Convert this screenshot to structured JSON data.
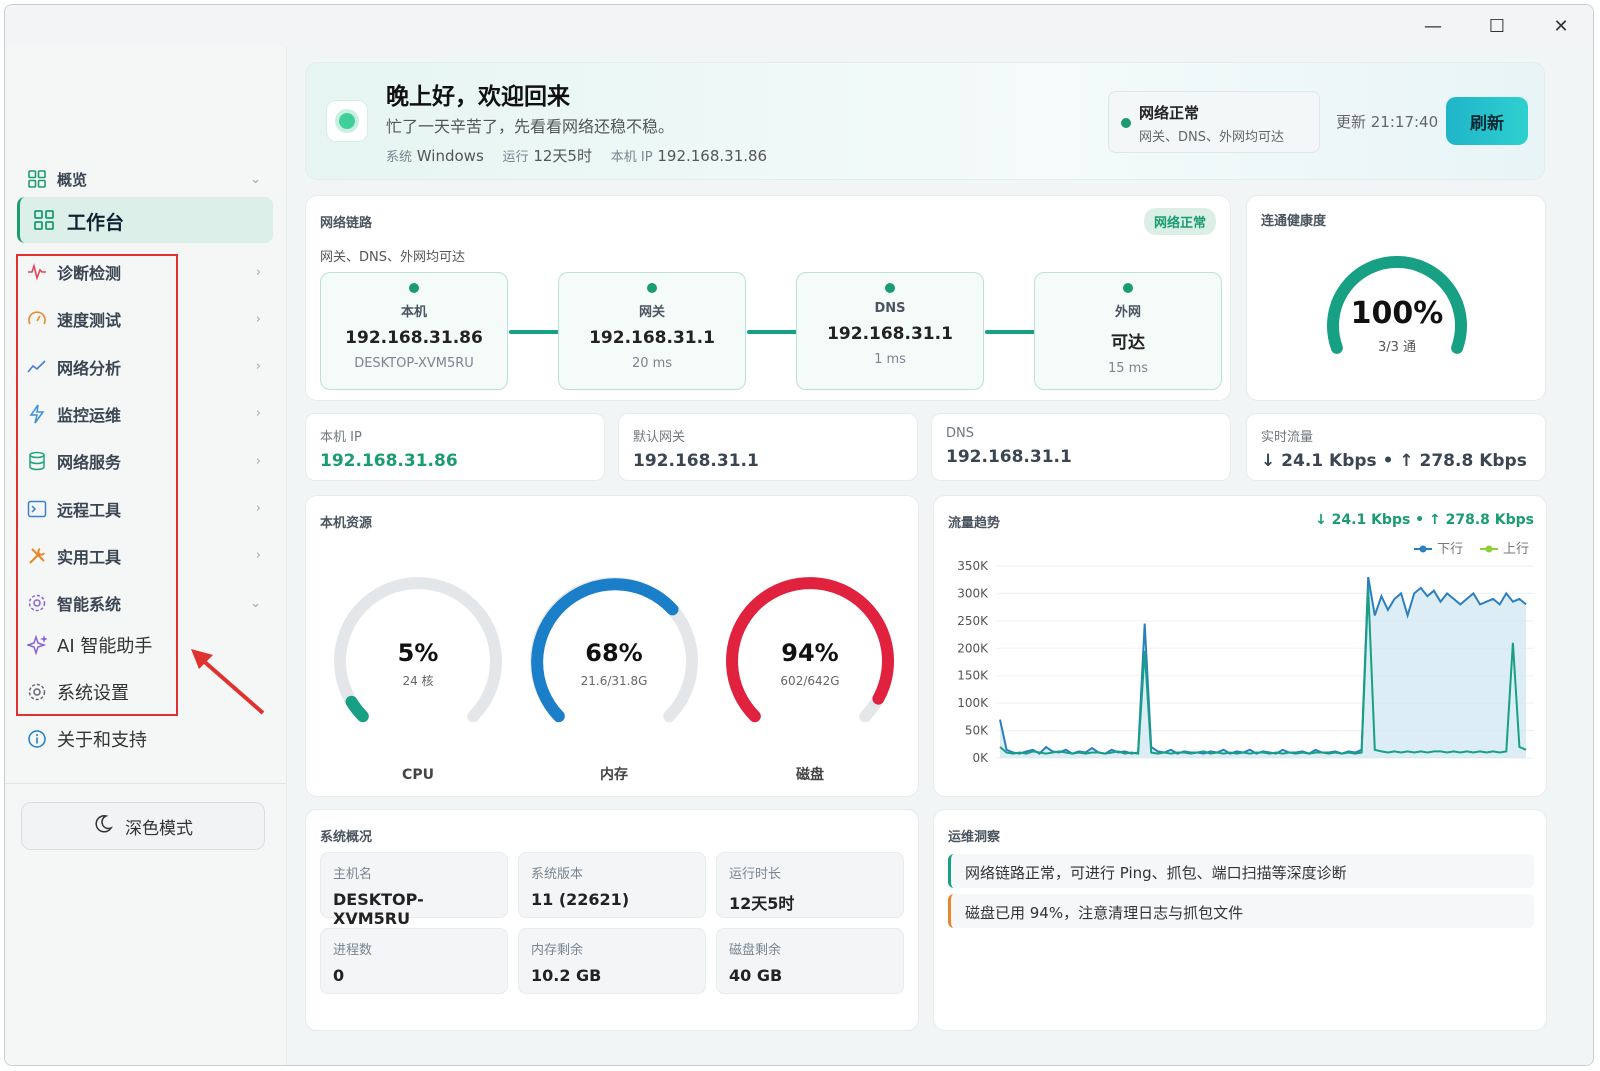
{
  "window": {
    "minimize_label": "—",
    "maximize_label": "☐",
    "close_label": "✕"
  },
  "sidebar": {
    "group_overview": "概览",
    "active_item": "工作台",
    "items": [
      {
        "label": "诊断检测",
        "icon": "pulse-icon",
        "color": "#e0485a"
      },
      {
        "label": "速度测试",
        "icon": "speedometer-icon",
        "color": "#e8872a"
      },
      {
        "label": "网络分析",
        "icon": "trend-icon",
        "color": "#4a7bd8"
      },
      {
        "label": "监控运维",
        "icon": "bolt-icon",
        "color": "#3a8fd8"
      },
      {
        "label": "网络服务",
        "icon": "database-icon",
        "color": "#1fa37e"
      },
      {
        "label": "远程工具",
        "icon": "terminal-icon",
        "color": "#3a7fd0"
      },
      {
        "label": "实用工具",
        "icon": "tools-icon",
        "color": "#e8872a"
      },
      {
        "label": "智能系统",
        "icon": "gear-icon",
        "color": "#8a63d2"
      }
    ],
    "sub_items": [
      {
        "label": "AI 智能助手",
        "icon": "sparkle-icon"
      },
      {
        "label": "系统设置",
        "icon": "gear-icon"
      }
    ],
    "about": "关于和支持",
    "dark_mode": "深色模式",
    "accent": "#1a9b72",
    "highlight_border": "#e03131"
  },
  "header": {
    "greeting": "晚上好，欢迎回来",
    "subtitle": "忙了一天辛苦了，先看看网络还稳不稳。",
    "sys_label": "系统",
    "sys_value": "Windows",
    "uptime_label": "运行",
    "uptime_value": "12天5时",
    "ip_label": "本机 IP",
    "ip_value": "192.168.31.86",
    "status_title": "网络正常",
    "status_desc": "网关、DNS、外网均可达",
    "update_time": "更新 21:17:40",
    "refresh": "刷新"
  },
  "link_card": {
    "title": "网络链路",
    "badge": "网络正常",
    "desc": "网关、DNS、外网均可达",
    "nodes": [
      {
        "name": "本机",
        "value": "192.168.31.86",
        "detail": "DESKTOP-XVM5RU"
      },
      {
        "name": "网关",
        "value": "192.168.31.1",
        "detail": "20 ms"
      },
      {
        "name": "DNS",
        "value": "192.168.31.1",
        "detail": "1 ms"
      },
      {
        "name": "外网",
        "value": "可达",
        "detail": "15 ms"
      }
    ]
  },
  "health": {
    "title": "连通健康度",
    "value": "100%",
    "sub": "3/3 通",
    "percent": 100
  },
  "stats": [
    {
      "label": "本机 IP",
      "value": "192.168.31.86"
    },
    {
      "label": "默认网关",
      "value": "192.168.31.1"
    },
    {
      "label": "DNS",
      "value": "192.168.31.1"
    },
    {
      "label": "实时流量",
      "value": "↓ 24.1 Kbps • ↑ 278.8 Kbps"
    }
  ],
  "resources": {
    "title": "本机资源",
    "gauges": [
      {
        "name": "CPU",
        "value": "5%",
        "sub": "24 核",
        "percent": 5,
        "color": "#17a083"
      },
      {
        "name": "内存",
        "value": "68%",
        "sub": "21.6/31.8G",
        "percent": 68,
        "color": "#1a7fc8"
      },
      {
        "name": "磁盘",
        "value": "94%",
        "sub": "602/642G",
        "percent": 94,
        "color": "#e0223f"
      }
    ]
  },
  "traffic": {
    "title": "流量趋势",
    "summary": "↓ 24.1 Kbps • ↑ 278.8 Kbps",
    "legend_down": "下行",
    "legend_up": "上行"
  },
  "chart_data": {
    "type": "line",
    "ylim": [
      0,
      350
    ],
    "y_ticks": [
      "0K",
      "50K",
      "100K",
      "150K",
      "200K",
      "250K",
      "300K",
      "350K"
    ],
    "series": [
      {
        "name": "下行",
        "color": "#2b7fc0",
        "values": [
          70,
          15,
          10,
          8,
          12,
          15,
          8,
          20,
          12,
          10,
          15,
          8,
          12,
          10,
          18,
          10,
          8,
          15,
          10,
          12,
          8,
          10,
          245,
          20,
          12,
          10,
          15,
          8,
          12,
          10,
          10,
          8,
          12,
          10,
          15,
          8,
          12,
          10,
          15,
          8,
          12,
          10,
          8,
          15,
          10,
          10,
          12,
          8,
          15,
          10,
          10,
          12,
          8,
          12,
          10,
          15,
          330,
          260,
          295,
          270,
          290,
          300,
          260,
          300,
          310,
          295,
          305,
          285,
          300,
          290,
          280,
          290,
          300,
          280,
          285,
          290,
          280,
          300,
          285,
          290,
          280
        ]
      },
      {
        "name": "上行",
        "color": "#17a083",
        "values": [
          20,
          10,
          8,
          10,
          8,
          12,
          10,
          8,
          10,
          12,
          10,
          8,
          10,
          8,
          10,
          10,
          8,
          10,
          12,
          8,
          10,
          8,
          195,
          10,
          8,
          10,
          8,
          10,
          10,
          8,
          10,
          12,
          8,
          10,
          8,
          10,
          8,
          10,
          8,
          10,
          10,
          8,
          10,
          8,
          10,
          8,
          10,
          8,
          10,
          10,
          8,
          10,
          8,
          10,
          8,
          10,
          310,
          15,
          12,
          10,
          12,
          10,
          12,
          10,
          12,
          10,
          12,
          12,
          10,
          12,
          10,
          12,
          10,
          12,
          10,
          12,
          10,
          12,
          210,
          20,
          15
        ]
      }
    ]
  },
  "overview": {
    "title": "系统概况",
    "items": [
      {
        "label": "主机名",
        "value": "DESKTOP-XVM5RU"
      },
      {
        "label": "系统版本",
        "value": "11 (22621)"
      },
      {
        "label": "运行时长",
        "value": "12天5时"
      },
      {
        "label": "进程数",
        "value": "0"
      },
      {
        "label": "内存剩余",
        "value": "10.2 GB"
      },
      {
        "label": "磁盘剩余",
        "value": "40 GB"
      }
    ]
  },
  "insights": {
    "title": "运维洞察",
    "items": [
      {
        "text": "网络链路正常，可进行 Ping、抓包、端口扫描等深度诊断",
        "color": "#17a083"
      },
      {
        "text": "磁盘已用 94%，注意清理日志与抓包文件",
        "color": "#e8872a"
      }
    ]
  }
}
